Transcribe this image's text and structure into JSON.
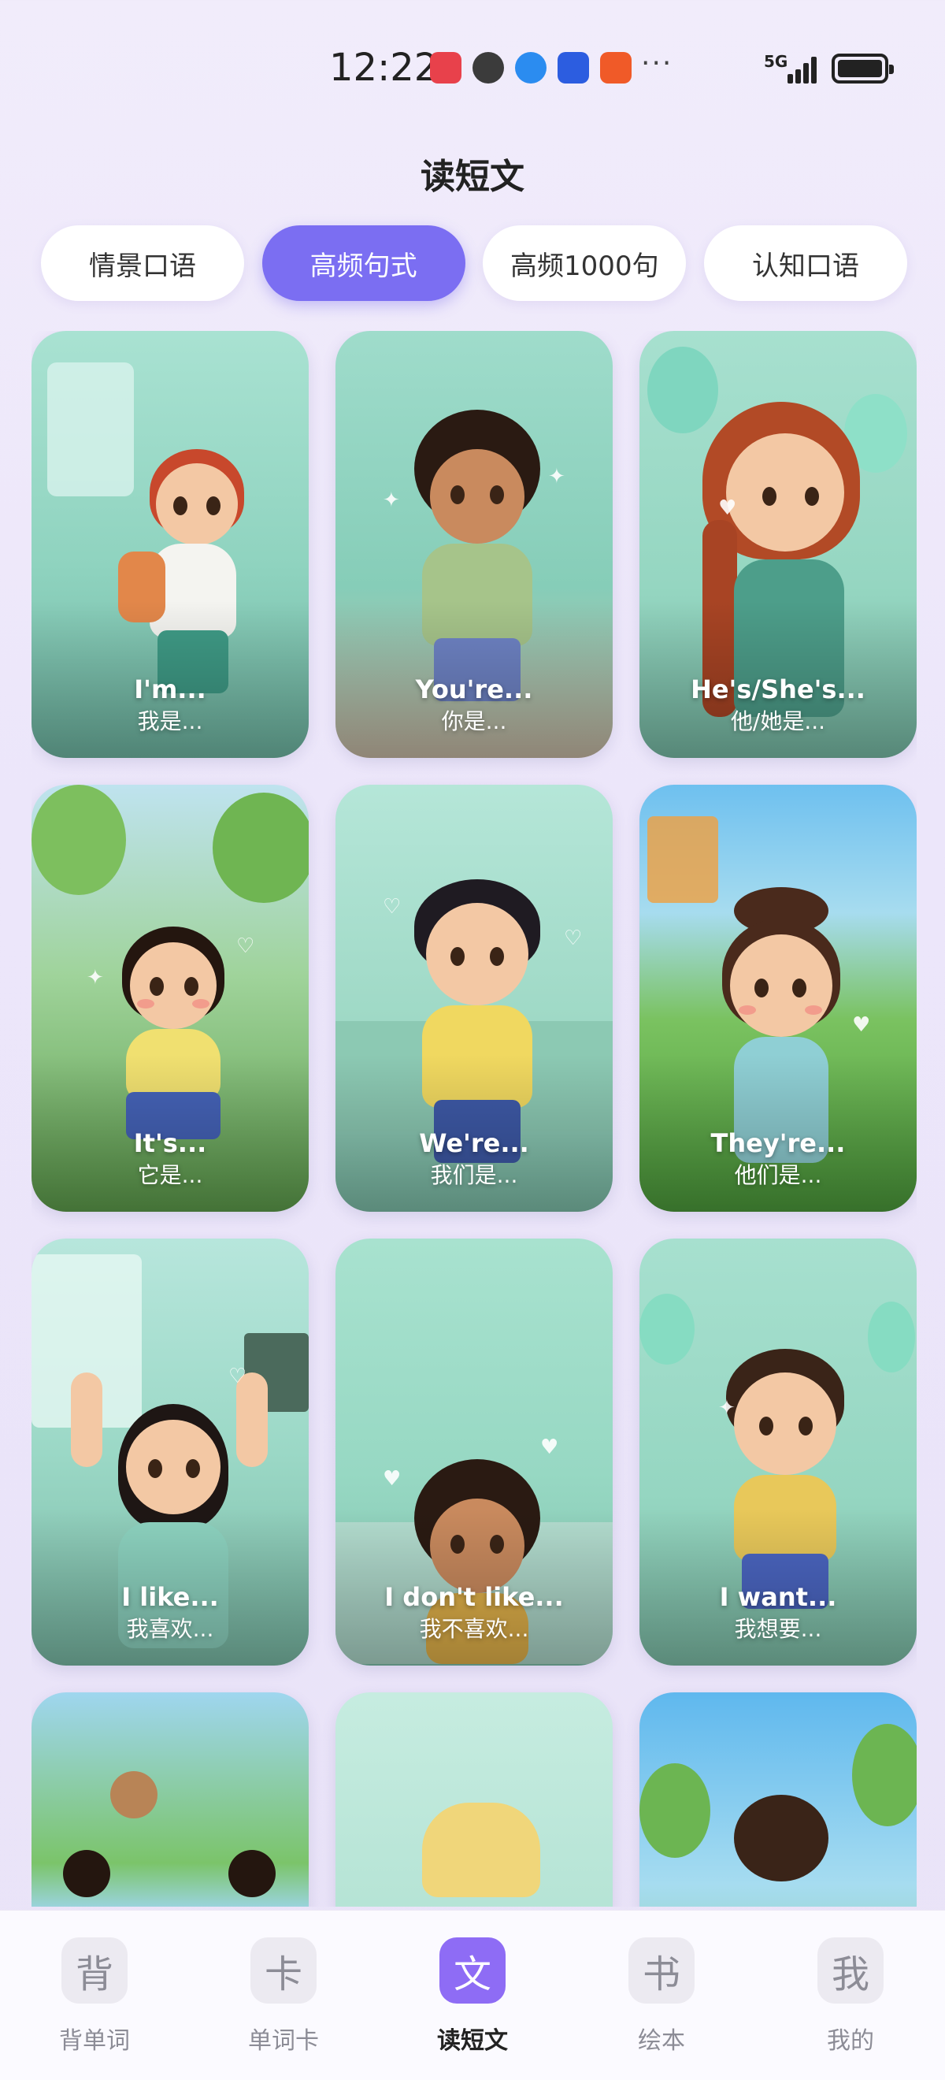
{
  "status_bar": {
    "time": "12:22",
    "network": "5G",
    "more": "···",
    "notification_icons": [
      "huawei-app-icon",
      "cat-app-icon",
      "browser-app-icon",
      "location-app-icon",
      "toutiao-app-icon"
    ]
  },
  "page": {
    "title": "读短文"
  },
  "tabs": [
    {
      "label": "情景口语",
      "active": false
    },
    {
      "label": "高频句式",
      "active": true
    },
    {
      "label": "高频1000句",
      "active": false
    },
    {
      "label": "认知口语",
      "active": false
    }
  ],
  "cards": [
    {
      "en": "I'm...",
      "zh": "我是..."
    },
    {
      "en": "You're...",
      "zh": "你是..."
    },
    {
      "en": "He's/She's...",
      "zh": "他/她是..."
    },
    {
      "en": "It's...",
      "zh": "它是..."
    },
    {
      "en": "We're...",
      "zh": "我们是..."
    },
    {
      "en": "They're...",
      "zh": "他们是..."
    },
    {
      "en": "I like...",
      "zh": "我喜欢..."
    },
    {
      "en": "I don't like...",
      "zh": "我不喜欢..."
    },
    {
      "en": "I want...",
      "zh": "我想要..."
    },
    {
      "en": "",
      "zh": ""
    },
    {
      "en": "",
      "zh": ""
    },
    {
      "en": "",
      "zh": ""
    }
  ],
  "bottom_nav": [
    {
      "icon": "背",
      "label": "背单词",
      "active": false
    },
    {
      "icon": "卡",
      "label": "单词卡",
      "active": false
    },
    {
      "icon": "文",
      "label": "读短文",
      "active": true
    },
    {
      "icon": "书",
      "label": "绘本",
      "active": false
    },
    {
      "icon": "我",
      "label": "我的",
      "active": false
    }
  ],
  "colors": {
    "accent": "#7b6ef2",
    "nav_active": "#8e6cf5",
    "background": "#ece6fa",
    "card_mint": "#9fdcc8"
  }
}
